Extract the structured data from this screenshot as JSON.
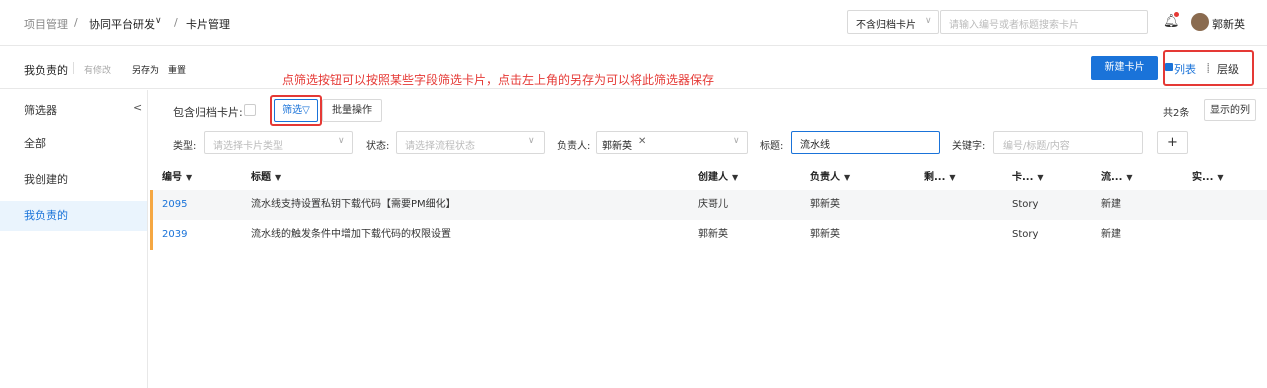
{
  "breadcrumb": {
    "item1": "项目管理",
    "sep1": "/",
    "item2": "协同平台研发",
    "sep2": "/",
    "item3": "卡片管理"
  },
  "header": {
    "archive_select": "不含归档卡片",
    "search_placeholder": "请输入编号或者标题搜索卡片",
    "user_name": "郭新英"
  },
  "toolbar": {
    "view_name": "我负责的",
    "modified": "有修改",
    "save_as": "另存为",
    "reset": "重置",
    "annotation": "点筛选按钮可以按照某些字段筛选卡片，点击左上角的另存为可以将此筛选器保存",
    "new_card": "新建卡片",
    "view_list": "列表",
    "view_tree": "层级"
  },
  "sidebar": {
    "title": "筛选器",
    "collapse": "<",
    "items": [
      {
        "label": "全部"
      },
      {
        "label": "我创建的"
      },
      {
        "label": "我负责的"
      }
    ]
  },
  "filters": {
    "include_archived": "包含归档卡片:",
    "filter_btn": "筛选",
    "batch_btn": "批量操作",
    "count": "共2条",
    "show_columns": "显示的列",
    "type_label": "类型:",
    "type_placeholder": "请选择卡片类型",
    "status_label": "状态:",
    "status_placeholder": "请选择流程状态",
    "owner_label": "负责人:",
    "owner_tag": "郭新英",
    "title_label": "标题:",
    "title_value": "流水线",
    "keyword_label": "关键字:",
    "keyword_placeholder": "编号/标题/内容",
    "add": "+"
  },
  "table": {
    "headers": [
      "编号",
      "标题",
      "创建人",
      "负责人",
      "剩...",
      "卡...",
      "流...",
      "实..."
    ],
    "rows": [
      {
        "id": "2095",
        "title": "流水线支持设置私钥下载代码【需要PM细化】",
        "creator": "庆哥儿",
        "owner": "郭新英",
        "remain": "",
        "card_type": "Story",
        "flow": "新建",
        "actual": ""
      },
      {
        "id": "2039",
        "title": "流水线的触发条件中增加下载代码的权限设置",
        "creator": "郭新英",
        "owner": "郭新英",
        "remain": "",
        "card_type": "Story",
        "flow": "新建",
        "actual": ""
      }
    ]
  },
  "colors": {
    "accent": "#1a73d9",
    "highlight": "#e53935",
    "row_bar": "#f5a742"
  }
}
